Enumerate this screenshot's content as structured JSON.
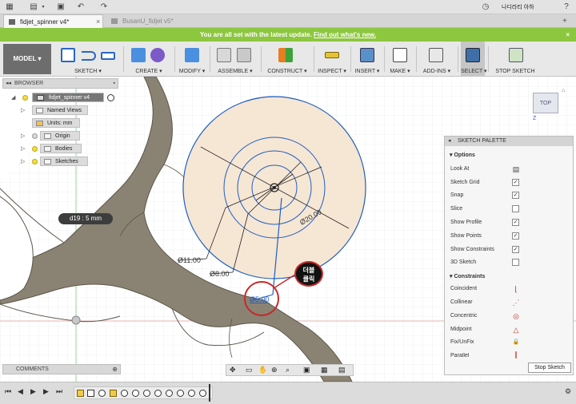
{
  "tabs": [
    {
      "label": "fidjet_spinner v4*",
      "active": true
    },
    {
      "label": "BusanU_fidjet v5*",
      "active": false
    }
  ],
  "user_name": "나디라티 아하",
  "banner": {
    "text": "You are all set with the latest update.",
    "link": "Find out what's new."
  },
  "toolbar": {
    "model": "MODEL ▾",
    "groups": [
      "SKETCH ▾",
      "CREATE ▾",
      "MODIFY ▾",
      "ASSEMBLE ▾",
      "CONSTRUCT ▾",
      "INSPECT ▾",
      "INSERT ▾",
      "MAKE ▾",
      "ADD-INS ▾",
      "SELECT ▾",
      "STOP SKETCH"
    ]
  },
  "browser": {
    "title": "BROWSER",
    "root": "fidjet_spinner v4",
    "items": [
      "Named Views",
      "Units: mm",
      "Origin",
      "Bodies",
      "Sketches"
    ]
  },
  "comments": "COMMENTS",
  "viewcube": "TOP",
  "axis_label": "Z",
  "dims": {
    "d19": "d19 : 5 mm",
    "d20": "Ø20.00",
    "d11": "Ø11.00",
    "d8": "Ø8.00",
    "d5": "Ø5.00"
  },
  "callout": {
    "line1": "더블",
    "line2": "클릭"
  },
  "palette": {
    "title": "SKETCH PALETTE",
    "options_title": "Options",
    "options": [
      {
        "label": "Look At",
        "type": "icon",
        "icon": "look-at-icon"
      },
      {
        "label": "Sketch Grid",
        "checked": true
      },
      {
        "label": "Snap",
        "checked": true
      },
      {
        "label": "Slice",
        "checked": false
      },
      {
        "label": "Show Profile",
        "checked": true
      },
      {
        "label": "Show Points",
        "checked": true
      },
      {
        "label": "Show Constraints",
        "checked": true
      },
      {
        "label": "3D Sketch",
        "checked": false
      }
    ],
    "constraints_title": "Constraints",
    "constraints": [
      {
        "label": "Coincident",
        "glyph": "⌊"
      },
      {
        "label": "Collinear",
        "glyph": "⋰"
      },
      {
        "label": "Concentric",
        "glyph": "◎"
      },
      {
        "label": "Midpoint",
        "glyph": "△"
      },
      {
        "label": "Fix/UnFix",
        "glyph": "🔒"
      },
      {
        "label": "Parallel",
        "glyph": "∥"
      }
    ],
    "stop": "Stop Sketch"
  },
  "colors": {
    "banner": "#8dc63f",
    "sketch_line": "#1f5fbf",
    "profile_fill": "#f6e6d4",
    "body": "#8a8373",
    "callout_ring": "#c62828"
  }
}
